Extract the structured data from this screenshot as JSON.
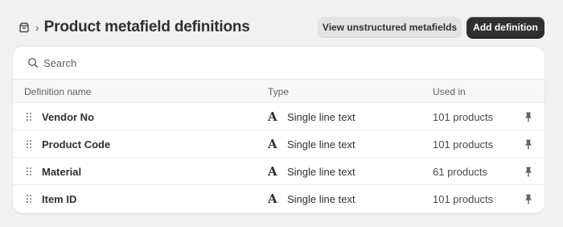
{
  "header": {
    "icon": "package-icon",
    "breadcrumb_chevron": "›",
    "title": "Product metafield definitions",
    "secondary_button": "View unstructured metafields",
    "primary_button": "Add definition"
  },
  "search": {
    "placeholder": "Search",
    "value": ""
  },
  "table": {
    "columns": [
      "Definition name",
      "Type",
      "Used in"
    ],
    "rows": [
      {
        "name": "Vendor No",
        "type_icon": "A",
        "type": "Single line text",
        "used_in": "101 products"
      },
      {
        "name": "Product Code",
        "type_icon": "A",
        "type": "Single line text",
        "used_in": "101 products"
      },
      {
        "name": "Material",
        "type_icon": "A",
        "type": "Single line text",
        "used_in": "61 products"
      },
      {
        "name": "Item ID",
        "type_icon": "A",
        "type": "Single line text",
        "used_in": "101 products"
      }
    ]
  },
  "colors": {
    "page_bg": "#f1f1f1",
    "primary_button_bg": "#303030",
    "secondary_button_bg": "#e3e3e3",
    "text": "#303030",
    "muted_text": "#616161"
  }
}
